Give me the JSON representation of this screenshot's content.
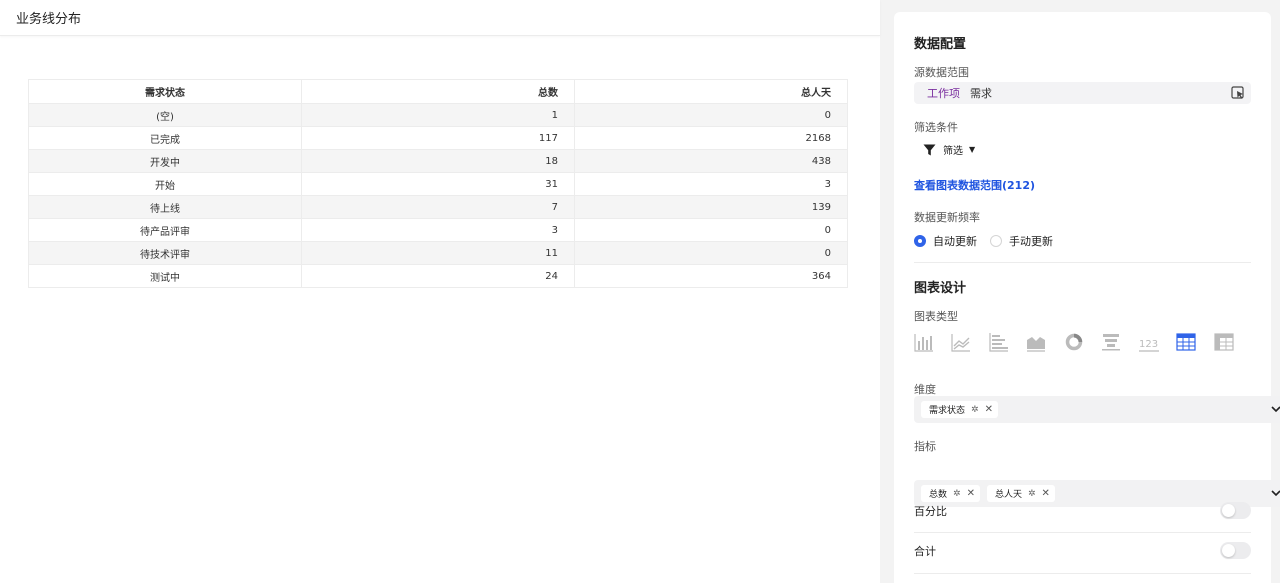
{
  "page": {
    "title": "业务线分布"
  },
  "table": {
    "headers": [
      "需求状态",
      "总数",
      "总人天"
    ],
    "rows": [
      [
        "(空)",
        "1",
        "0"
      ],
      [
        "已完成",
        "117",
        "2168"
      ],
      [
        "开发中",
        "18",
        "438"
      ],
      [
        "开始",
        "31",
        "3"
      ],
      [
        "待上线",
        "7",
        "139"
      ],
      [
        "待产品评审",
        "3",
        "0"
      ],
      [
        "待技术评审",
        "11",
        "0"
      ],
      [
        "测试中",
        "24",
        "364"
      ]
    ]
  },
  "panel": {
    "data_config_title": "数据配置",
    "source_label": "源数据范围",
    "source_type": "工作项",
    "source_name": "需求",
    "filter_label": "筛选条件",
    "filter_button": "筛选",
    "view_range_link": "查看图表数据范围(212)",
    "update_freq_label": "数据更新频率",
    "auto_update": "自动更新",
    "manual_update": "手动更新",
    "chart_design_title": "图表设计",
    "chart_type_label": "图表类型",
    "chart_types": [
      "bar-chart",
      "line-chart",
      "horizontal-bar-chart",
      "area-chart",
      "pie-chart",
      "funnel-chart",
      "number-card",
      "table",
      "pivot-table"
    ],
    "selected_chart_type": "table",
    "dimension_label": "维度",
    "dimensions": [
      "需求状态"
    ],
    "metric_label": "指标",
    "metrics": [
      "总数",
      "总人天"
    ],
    "percentage_label": "百分比",
    "percentage_on": false,
    "total_label": "合计",
    "total_on": false
  },
  "colors": {
    "accent": "#2f63e8",
    "link": "#1f54e0",
    "source_type": "#7a2e9e"
  }
}
